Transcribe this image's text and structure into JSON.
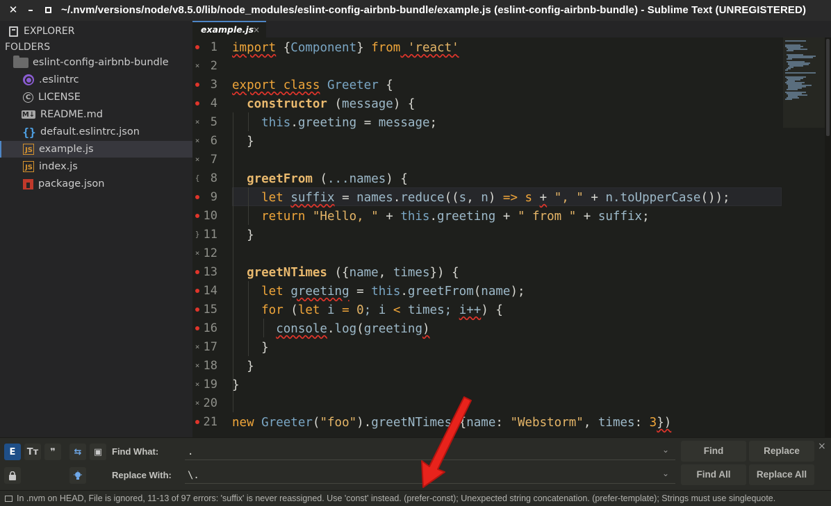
{
  "window": {
    "title": "~/.nvm/versions/node/v8.5.0/lib/node_modules/eslint-config-airbnb-bundle/example.js (eslint-config-airbnb-bundle) - Sublime Text (UNREGISTERED)",
    "close_glyph": "✕",
    "minimize_glyph": "–"
  },
  "sidebar": {
    "explorer_label": "EXPLORER",
    "folders_label": "FOLDERS",
    "root_folder": "eslint-config-airbnb-bundle",
    "files": [
      {
        "name": ".eslintrc",
        "icon": "eslint-icon"
      },
      {
        "name": "LICENSE",
        "icon": "license-icon",
        "glyph": "C"
      },
      {
        "name": "README.md",
        "icon": "markdown-icon",
        "glyph": "M↓"
      },
      {
        "name": "default.eslintrc.json",
        "icon": "json-icon",
        "glyph": "{}"
      },
      {
        "name": "example.js",
        "icon": "js-icon",
        "glyph": "JS",
        "selected": true
      },
      {
        "name": "index.js",
        "icon": "js-icon",
        "glyph": "JS"
      },
      {
        "name": "package.json",
        "icon": "npm-icon"
      }
    ]
  },
  "tabs": [
    {
      "label": "example.js",
      "close": "×",
      "active": true
    }
  ],
  "editor": {
    "gutter": [
      {
        "n": "1",
        "mark": "dot"
      },
      {
        "n": "2",
        "mark": "×"
      },
      {
        "n": "3",
        "mark": "dot"
      },
      {
        "n": "4",
        "mark": "dot"
      },
      {
        "n": "5",
        "mark": "×"
      },
      {
        "n": "6",
        "mark": "×"
      },
      {
        "n": "7",
        "mark": "×"
      },
      {
        "n": "8",
        "mark": "{"
      },
      {
        "n": "9",
        "mark": "dot"
      },
      {
        "n": "10",
        "mark": "dot"
      },
      {
        "n": "11",
        "mark": "}"
      },
      {
        "n": "12",
        "mark": "×"
      },
      {
        "n": "13",
        "mark": "dot"
      },
      {
        "n": "14",
        "mark": "dot"
      },
      {
        "n": "15",
        "mark": "dot"
      },
      {
        "n": "16",
        "mark": "dot"
      },
      {
        "n": "17",
        "mark": "×"
      },
      {
        "n": "18",
        "mark": "×"
      },
      {
        "n": "19",
        "mark": "×"
      },
      {
        "n": "20",
        "mark": "×"
      },
      {
        "n": "21",
        "mark": "dot"
      }
    ],
    "code": {
      "l1_kw": "import",
      "l1_a": " {",
      "l1_cls": "Component",
      "l1_b": "} ",
      "l1_from": "from",
      "l1_str": " 'react'",
      "l3_kw": "export class",
      "l3_cls": " Greeter",
      "l3_b": " {",
      "l4_fn": "  constructor",
      "l4_a": " (",
      "l4_prm": "message",
      "l4_b": ") {",
      "l5_a": "    ",
      "l5_this": "this",
      "l5_b": ".",
      "l5_prop": "greeting",
      "l5_c": " = ",
      "l5_prm": "message",
      "l5_d": ";",
      "l6": "  }",
      "l8_fn": "  greetFrom",
      "l8_a": " (",
      "l8_prm": "...names",
      "l8_b": ") {",
      "l9_kw": "    let",
      "l9_a": " ",
      "l9_var": "suffix",
      "l9_b": " = ",
      "l9_c": "names",
      "l9_d": ".",
      "l9_e": "reduce",
      "l9_f": "((",
      "l9_g": "s",
      "l9_h": ", ",
      "l9_i": "n",
      "l9_j": ") ",
      "l9_k": "=>",
      "l9_l": " s ",
      "l9_m": "+",
      "l9_n": " \", \" ",
      "l9_o": "+",
      "l9_p": " n.",
      "l9_q": "toUpperCase",
      "l9_r": "());",
      "l10_kw": "    return",
      "l10_a": " \"Hello, \"",
      "l10_b": " + ",
      "l10_this": "this",
      "l10_c": ".",
      "l10_prop": "greeting",
      "l10_d": " + ",
      "l10_e": "\" from \"",
      "l10_f": " + ",
      "l10_g": "suffix",
      "l10_h": ";",
      "l11": "  }",
      "l13_fn": "  greetNTimes",
      "l13_a": " ({",
      "l13_prm": "name",
      "l13_b": ", ",
      "l13_prm2": "times",
      "l13_c": "}) {",
      "l14_kw": "    let",
      "l14_a": " ",
      "l14_var": "greeting",
      "l14_b": " = ",
      "l14_this": "this",
      "l14_c": ".",
      "l14_d": "greetFrom",
      "l14_e": "(",
      "l14_f": "name",
      "l14_g": ");",
      "l15_kw": "    for",
      "l15_a": " (",
      "l15_kw2": "let",
      "l15_b": " i ",
      "l15_c": "=",
      "l15_d": " ",
      "l15_num": "0",
      "l15_e": "; i ",
      "l15_f": "<",
      "l15_g": " times; ",
      "l15_h": "i++",
      "l15_i": ") {",
      "l16_a": "      ",
      "l16_b": "console",
      "l16_c": ".",
      "l16_d": "log",
      "l16_e": "(",
      "l16_f": "greeting",
      "l16_g": ")",
      "l17": "    }",
      "l18": "  }",
      "l19": "}",
      "l21_kw": "new",
      "l21_a": " ",
      "l21_cls": "Greeter",
      "l21_b": "(",
      "l21_str": "\"foo\"",
      "l21_c": ").",
      "l21_d": "greetNTimes",
      "l21_e": "({",
      "l21_f": "name",
      "l21_g": ": ",
      "l21_str2": "\"Webstorm\"",
      "l21_h": ", ",
      "l21_i": "times",
      "l21_j": ": ",
      "l21_num": "3",
      "l21_k": "})"
    }
  },
  "find_panel": {
    "toggles": {
      "regex": "E",
      "case": "Tт",
      "word": "❞",
      "wrap": "⇆",
      "in_selection": "▣",
      "preserve_case": "🔒",
      "highlight": "✦"
    },
    "find_label": "Find What:",
    "find_value": ".",
    "replace_label": "Replace With:",
    "replace_value": "\\.",
    "dropdown_glyph": "⌄",
    "buttons": {
      "find": "Find",
      "replace": "Replace",
      "find_all": "Find All",
      "replace_all": "Replace All"
    },
    "close": "×"
  },
  "status_bar": {
    "text": "In .nvm on HEAD, File is ignored, 11-13 of 97 errors: 'suffix' is never reassigned. Use 'const' instead. (prefer-const); Unexpected string concatenation. (prefer-template); Strings must use singlequote."
  },
  "colors": {
    "accent": "#4e86c6",
    "error": "#e0352b",
    "keyword": "#f0a63a",
    "annotation_arrow": "#e8231c"
  }
}
